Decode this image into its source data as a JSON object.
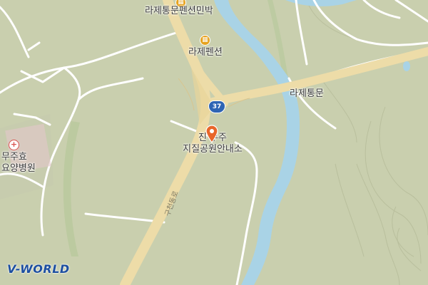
{
  "map": {
    "labels": {
      "pension_minbak": "라제통문펜션민박",
      "pension": "라제펜션",
      "tunnel": "라제통문",
      "visitor_center_line1": "진  무주",
      "visitor_center_line2": "지질공원안내소",
      "hospital_line1": "무주효",
      "hospital_line2": "요양병원",
      "road_name": "구천동로"
    },
    "route_shield": "37",
    "icons": {
      "pension": "lodging-icon",
      "hospital": "hospital-icon",
      "selected_place": "location-pin-icon"
    },
    "colors": {
      "land": "#c9cfae",
      "river": "#a9d3e6",
      "highway": "#eddca8",
      "local_road": "#ffffff",
      "pin": "#e8662a",
      "shield": "#2e64b4"
    },
    "logo": "V-WORLD"
  }
}
